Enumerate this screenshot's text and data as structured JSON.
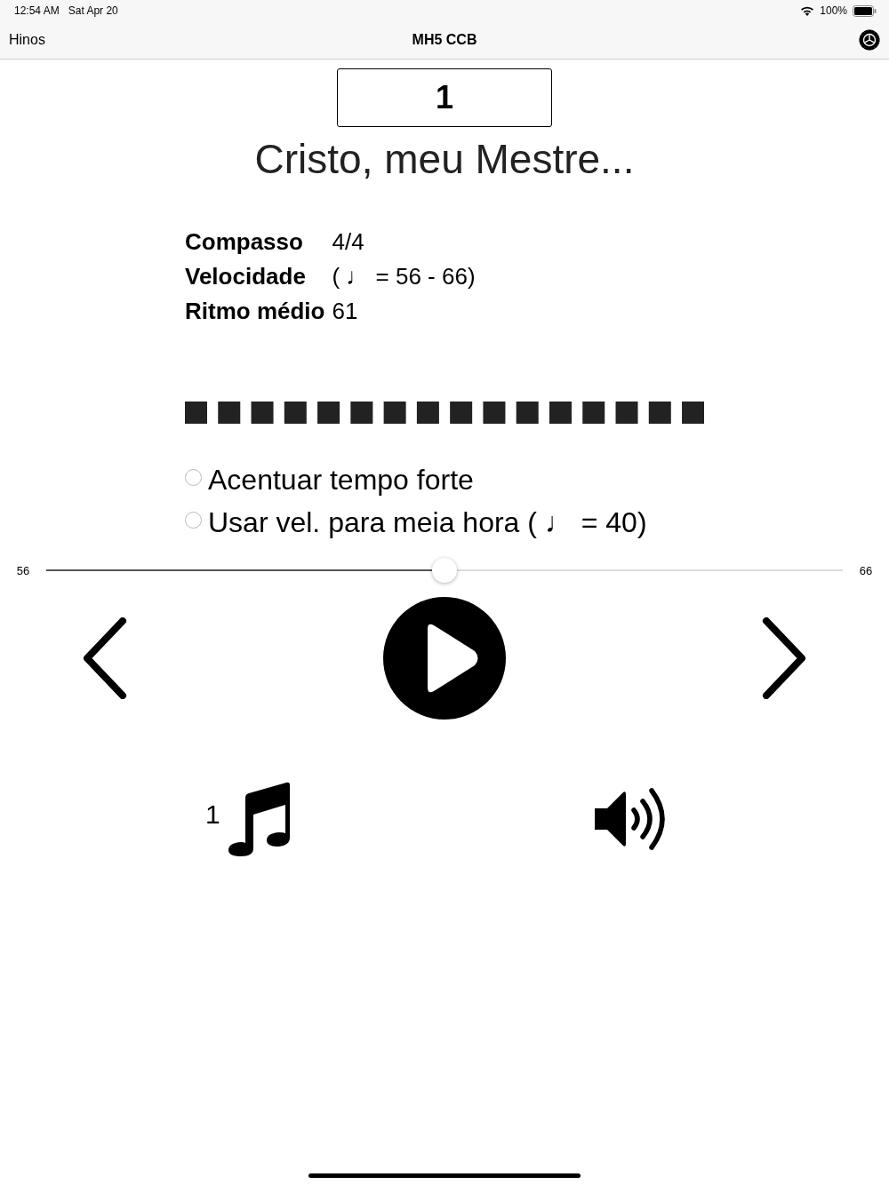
{
  "status_bar": {
    "time": "12:54 AM",
    "date": "Sat Apr 20",
    "battery": "100%"
  },
  "nav": {
    "back": "Hinos",
    "title": "MH5 CCB"
  },
  "hymn": {
    "number": "1",
    "title": "Cristo, meu Mestre..."
  },
  "info": [
    {
      "label": "Compasso",
      "value": "4/4"
    },
    {
      "label": "Velocidade",
      "value": "( ♩ = 56 - 66)"
    },
    {
      "label": "Ritmo médio",
      "value": "61"
    }
  ],
  "options": [
    {
      "label": "Acentuar tempo forte",
      "checked": false
    },
    {
      "label": "Usar vel. para meia hora ( ♩ = 40)",
      "checked": false
    }
  ],
  "tempo_slider": {
    "min_label": "56",
    "max_label": "66",
    "level": 0.5
  },
  "part_label": "1"
}
